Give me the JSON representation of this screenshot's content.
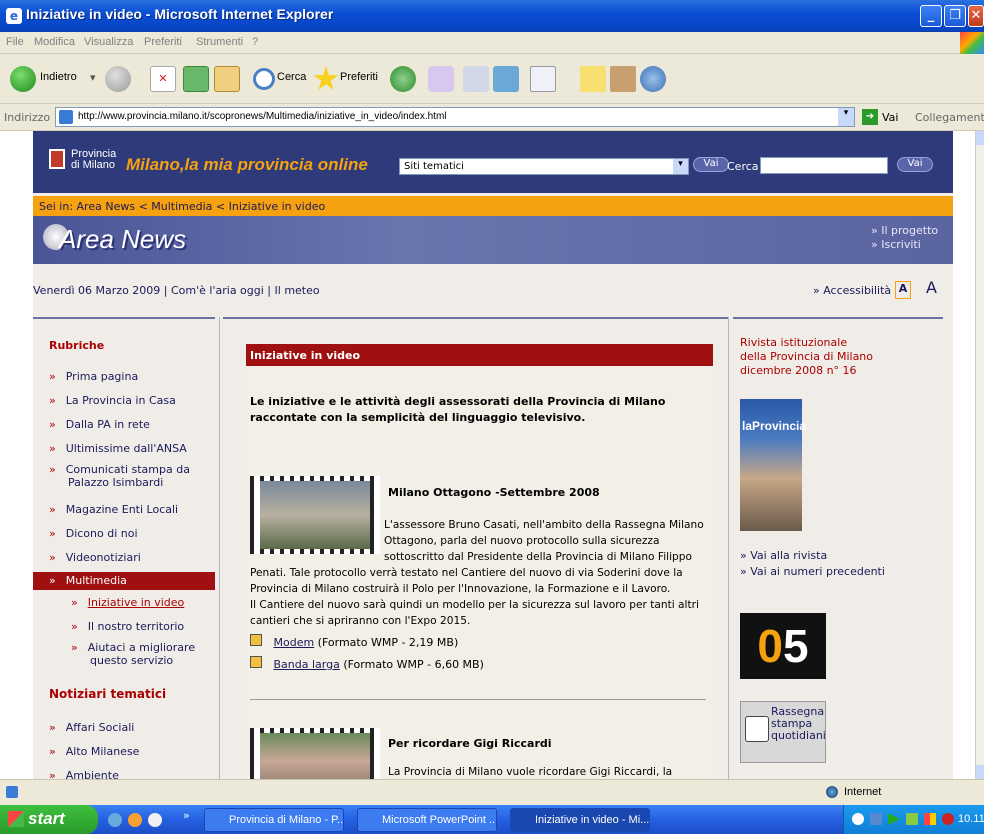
{
  "window": {
    "title": "Iniziative in video - Microsoft Internet Explorer"
  },
  "menu": [
    "File",
    "Modifica",
    "Visualizza",
    "Preferiti",
    "Strumenti",
    "?"
  ],
  "toolbar": {
    "back": "Indietro",
    "search": "Cerca",
    "favorites": "Preferiti"
  },
  "address": {
    "label": "Indirizzo",
    "url": "http://www.provincia.milano.it/scopronews/Multimedia/iniziative_in_video/index.html",
    "go": "Vai",
    "links": "Collegamenti"
  },
  "site": {
    "logo_line1": "Provincia",
    "logo_line2": "di Milano",
    "slogan": "Milano,la mia provincia online",
    "themes_select": "Siti tematici",
    "go1": "Vai",
    "search_label": "Cerca",
    "go2": "Vai"
  },
  "breadcrumb": "Sei in: Area News < Multimedia < Iniziative in video",
  "area": {
    "title": "Area News",
    "link1": "» Il progetto",
    "link2": "» Iscriviti"
  },
  "datebar": {
    "date": "Venerdì 06 Marzo 2009",
    "link1": "Com'è l'aria oggi",
    "link2": "Il meteo",
    "access": "» Accessibilità",
    "a_small": "A",
    "a_big": "A"
  },
  "left": {
    "heading1": "Rubriche",
    "items": [
      "Prima pagina",
      "La Provincia in Casa",
      "Dalla PA in rete",
      "Ultimissime dall'ANSA",
      "Comunicati stampa da Palazzo Isimbardi",
      "Magazine Enti Locali",
      "Dicono di noi",
      "Videonotiziari",
      "Multimedia"
    ],
    "sub": [
      "Iniziative in video",
      "Il nostro territorio",
      "Aiutaci a migliorare questo servizio"
    ],
    "heading2": "Notiziari tematici",
    "items2": [
      "Affari Sociali",
      "Alto Milanese",
      "Ambiente"
    ]
  },
  "main": {
    "header": "Iniziative in video",
    "intro": "Le iniziative e le attività degli assessorati della Provincia di Milano raccontate con la semplicità del linguaggio televisivo.",
    "art1_title": "Milano Ottagono -Settembre 2008",
    "art1_p1": "L'assessore Bruno Casati, nell'ambito della Rassegna Milano Ottagono, parla del nuovo protocollo sulla sicurezza sottoscritto dal Presidente della Provincia di Milano Filippo Penati. Tale protocollo verrà testato nel Cantiere del nuovo di via Soderini dove la Provincia di Milano costruirà il Polo per l'Innovazione, la Formazione e il Lavoro.",
    "art1_p2": "Il Cantiere del nuovo sarà quindi un modello per la sicurezza sul lavoro per tanti altri cantieri che si apriranno con l'Expo 2015.",
    "dl1_link": "Modem",
    "dl1_info": " (Formato WMP - 2,19 MB)",
    "dl2_link": "Banda larga",
    "dl2_info": " (Formato WMP - 6,60 MB)",
    "art2_title": "Per ricordare Gigi Riccardi",
    "art2_p": "La Provincia di Milano vuole ricordare Gigi Riccardi, la"
  },
  "right": {
    "mag_line1": "Rivista istituzionale",
    "mag_line2": "della Provincia di Milano",
    "mag_line3": "dicembre 2008 n° 16",
    "cover_title": "laProvincia",
    "link1": "» Vai alla rivista",
    "link2": "» Vai ai numeri precedenti",
    "badge": "05",
    "press1": "Rassegna",
    "press2": "stampa",
    "press3": "quotidiani"
  },
  "status": {
    "zone": "Internet"
  },
  "taskbar": {
    "start": "start",
    "tasks": [
      "Provincia di Milano - P...",
      "Microsoft PowerPoint ...",
      "Iniziative in video - Mi..."
    ],
    "clock": "10.11"
  }
}
